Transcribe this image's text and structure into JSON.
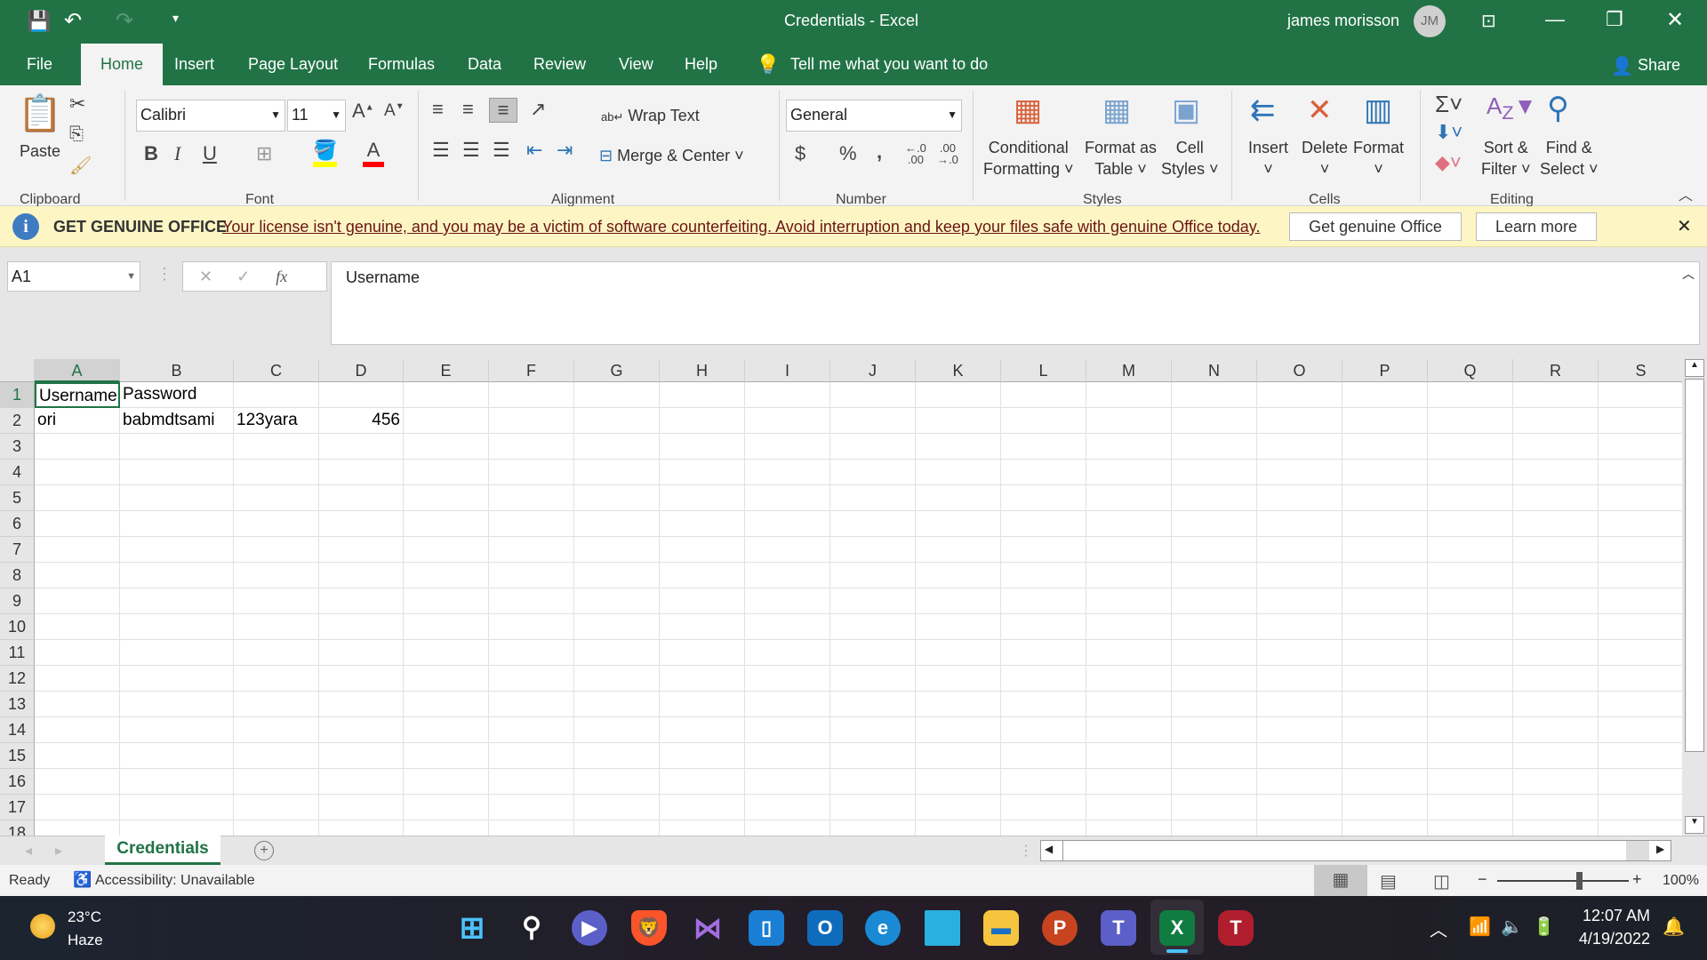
{
  "window": {
    "title": "Credentials  -  Excel",
    "user": "james morisson",
    "avatar": "JM"
  },
  "menu_tabs": [
    "File",
    "Home",
    "Insert",
    "Page Layout",
    "Formulas",
    "Data",
    "Review",
    "View",
    "Help"
  ],
  "active_tab": "Home",
  "tell_me": "Tell me what you want to do",
  "share": "Share",
  "ribbon": {
    "clipboard": {
      "label": "Clipboard",
      "paste": "Paste"
    },
    "font": {
      "label": "Font",
      "name": "Calibri",
      "size": "11",
      "bold": "B",
      "italic": "I",
      "underline": "U",
      "fill_color": "#ffff00",
      "font_color": "#ff0000"
    },
    "alignment": {
      "label": "Alignment",
      "wrap": "Wrap Text",
      "merge": "Merge & Center"
    },
    "number": {
      "label": "Number",
      "format": "General",
      "currency": "$",
      "percent": "%",
      "comma": ","
    },
    "styles": {
      "label": "Styles",
      "conditional": [
        "Conditional",
        "Formatting"
      ],
      "format_table": [
        "Format as",
        "Table"
      ],
      "cell_styles": [
        "Cell",
        "Styles"
      ]
    },
    "cells": {
      "label": "Cells",
      "insert": "Insert",
      "delete": "Delete",
      "format": "Format"
    },
    "editing": {
      "label": "Editing",
      "sort": [
        "Sort &",
        "Filter"
      ],
      "find": [
        "Find &",
        "Select"
      ]
    }
  },
  "banner": {
    "title": "GET GENUINE OFFICE",
    "message": "Your license isn't genuine, and you may be a victim of software counterfeiting. Avoid interruption and keep your files safe with genuine Office today.",
    "button1": "Get genuine Office",
    "button2": "Learn more"
  },
  "formula_bar": {
    "name_box": "A1",
    "content": "Username",
    "fx": "fx"
  },
  "sheet": {
    "columns": [
      "A",
      "B",
      "C",
      "D",
      "E",
      "F",
      "G",
      "H",
      "I",
      "J",
      "K",
      "L",
      "M",
      "N",
      "O",
      "P",
      "Q",
      "R",
      "S"
    ],
    "rows": [
      "1",
      "2",
      "3",
      "4",
      "5",
      "6",
      "7",
      "8",
      "9",
      "10",
      "11",
      "12",
      "13",
      "14",
      "15",
      "16",
      "17",
      "18"
    ],
    "cells": [
      [
        "Username",
        "Password",
        "",
        ""
      ],
      [
        "ori",
        "babmdtsami",
        "123yara",
        "456"
      ]
    ],
    "selected": "A1"
  },
  "sheet_tabs": [
    "Credentials"
  ],
  "status": {
    "ready": "Ready",
    "accessibility": "Accessibility: Unavailable",
    "zoom": "100%",
    "zoom_percent": 100
  },
  "taskbar": {
    "weather_temp": "23°C",
    "weather_desc": "Haze",
    "time": "12:07 AM",
    "date": "4/19/2022"
  }
}
